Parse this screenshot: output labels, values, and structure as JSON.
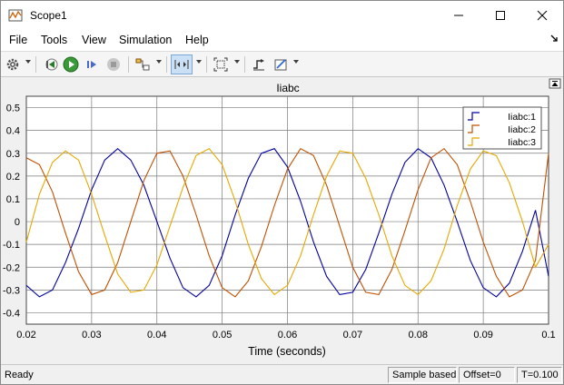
{
  "window": {
    "title": "Scope1"
  },
  "menu": {
    "items": [
      "File",
      "Tools",
      "View",
      "Simulation",
      "Help"
    ]
  },
  "toolbar": {
    "icons": [
      "gear-icon",
      "step-back-icon",
      "run-icon",
      "step-forward-icon",
      "stop-icon",
      "signal-selector-icon",
      "zoom-icon",
      "fit-to-view-icon",
      "triggers-icon",
      "measurements-icon"
    ]
  },
  "status": {
    "ready": "Ready",
    "sample_mode": "Sample based",
    "offset": "Offset=0",
    "time": "T=0.100"
  },
  "colors": {
    "series1": "#0000a0",
    "series2": "#c05000",
    "series3": "#e6a800",
    "plot_bg": "#ffffff",
    "grid": "#7a7a7a"
  },
  "chart_data": {
    "type": "line",
    "title": "Iiabc",
    "xlabel": "Time (seconds)",
    "ylabel": "",
    "xlim": [
      0.02,
      0.1
    ],
    "ylim": [
      -0.45,
      0.55
    ],
    "xticks": [
      0.02,
      0.03,
      0.04,
      0.05,
      0.06,
      0.07,
      0.08,
      0.09,
      0.1
    ],
    "xtick_labels": [
      "0.02",
      "0.03",
      "0.04",
      "0.05",
      "0.06",
      "0.07",
      "0.08",
      "0.09",
      "0.1"
    ],
    "yticks": [
      -0.4,
      -0.3,
      -0.2,
      -0.1,
      0,
      0.1,
      0.2,
      0.3,
      0.4,
      0.5
    ],
    "ytick_labels": [
      "-0.4",
      "-0.3",
      "-0.2",
      "-0.1",
      "0",
      "0.1",
      "0.2",
      "0.3",
      "0.4",
      "0.5"
    ],
    "grid": true,
    "legend": "top-right",
    "series": [
      {
        "name": "Iiabc:1",
        "color": "#0000a0",
        "x": [
          0.02,
          0.022,
          0.024,
          0.026,
          0.028,
          0.03,
          0.032,
          0.034,
          0.036,
          0.038,
          0.04,
          0.042,
          0.044,
          0.046,
          0.048,
          0.05,
          0.052,
          0.054,
          0.056,
          0.058,
          0.06,
          0.062,
          0.064,
          0.066,
          0.068,
          0.07,
          0.072,
          0.074,
          0.076,
          0.078,
          0.08,
          0.082,
          0.084,
          0.086,
          0.088,
          0.09,
          0.092,
          0.094,
          0.096,
          0.098,
          0.1
        ],
        "y": [
          -0.28,
          -0.33,
          -0.3,
          -0.18,
          -0.03,
          0.14,
          0.27,
          0.32,
          0.27,
          0.16,
          0.0,
          -0.16,
          -0.29,
          -0.33,
          -0.28,
          -0.15,
          0.03,
          0.19,
          0.3,
          0.32,
          0.24,
          0.09,
          -0.09,
          -0.24,
          -0.32,
          -0.31,
          -0.21,
          -0.05,
          0.12,
          0.26,
          0.32,
          0.28,
          0.16,
          0.0,
          -0.17,
          -0.29,
          -0.33,
          -0.27,
          -0.13,
          0.05,
          -0.24
        ]
      },
      {
        "name": "Iiabc:2",
        "color": "#c05000",
        "x": [
          0.02,
          0.022,
          0.024,
          0.026,
          0.028,
          0.03,
          0.032,
          0.034,
          0.036,
          0.038,
          0.04,
          0.042,
          0.044,
          0.046,
          0.048,
          0.05,
          0.052,
          0.054,
          0.056,
          0.058,
          0.06,
          0.062,
          0.064,
          0.066,
          0.068,
          0.07,
          0.072,
          0.074,
          0.076,
          0.078,
          0.08,
          0.082,
          0.084,
          0.086,
          0.088,
          0.09,
          0.092,
          0.094,
          0.096,
          0.098,
          0.1
        ],
        "y": [
          0.28,
          0.25,
          0.13,
          -0.05,
          -0.22,
          -0.32,
          -0.3,
          -0.18,
          0.0,
          0.18,
          0.3,
          0.31,
          0.2,
          0.03,
          -0.15,
          -0.29,
          -0.33,
          -0.26,
          -0.11,
          0.07,
          0.23,
          0.32,
          0.29,
          0.16,
          -0.02,
          -0.2,
          -0.31,
          -0.32,
          -0.21,
          -0.04,
          0.14,
          0.28,
          0.32,
          0.25,
          0.09,
          -0.09,
          -0.24,
          -0.33,
          -0.3,
          -0.17,
          0.3
        ]
      },
      {
        "name": "Iiabc:3",
        "color": "#e6a800",
        "x": [
          0.02,
          0.022,
          0.024,
          0.026,
          0.028,
          0.03,
          0.032,
          0.034,
          0.036,
          0.038,
          0.04,
          0.042,
          0.044,
          0.046,
          0.048,
          0.05,
          0.052,
          0.054,
          0.056,
          0.058,
          0.06,
          0.062,
          0.064,
          0.066,
          0.068,
          0.07,
          0.072,
          0.074,
          0.076,
          0.078,
          0.08,
          0.082,
          0.084,
          0.086,
          0.088,
          0.09,
          0.092,
          0.094,
          0.096,
          0.098,
          0.1
        ],
        "y": [
          -0.09,
          0.12,
          0.26,
          0.31,
          0.27,
          0.12,
          -0.06,
          -0.23,
          -0.31,
          -0.3,
          -0.19,
          -0.02,
          0.15,
          0.29,
          0.32,
          0.25,
          0.09,
          -0.1,
          -0.25,
          -0.32,
          -0.28,
          -0.15,
          0.03,
          0.2,
          0.31,
          0.3,
          0.19,
          0.03,
          -0.15,
          -0.28,
          -0.32,
          -0.26,
          -0.12,
          0.07,
          0.23,
          0.31,
          0.29,
          0.17,
          0.0,
          -0.2,
          -0.1
        ]
      }
    ]
  }
}
